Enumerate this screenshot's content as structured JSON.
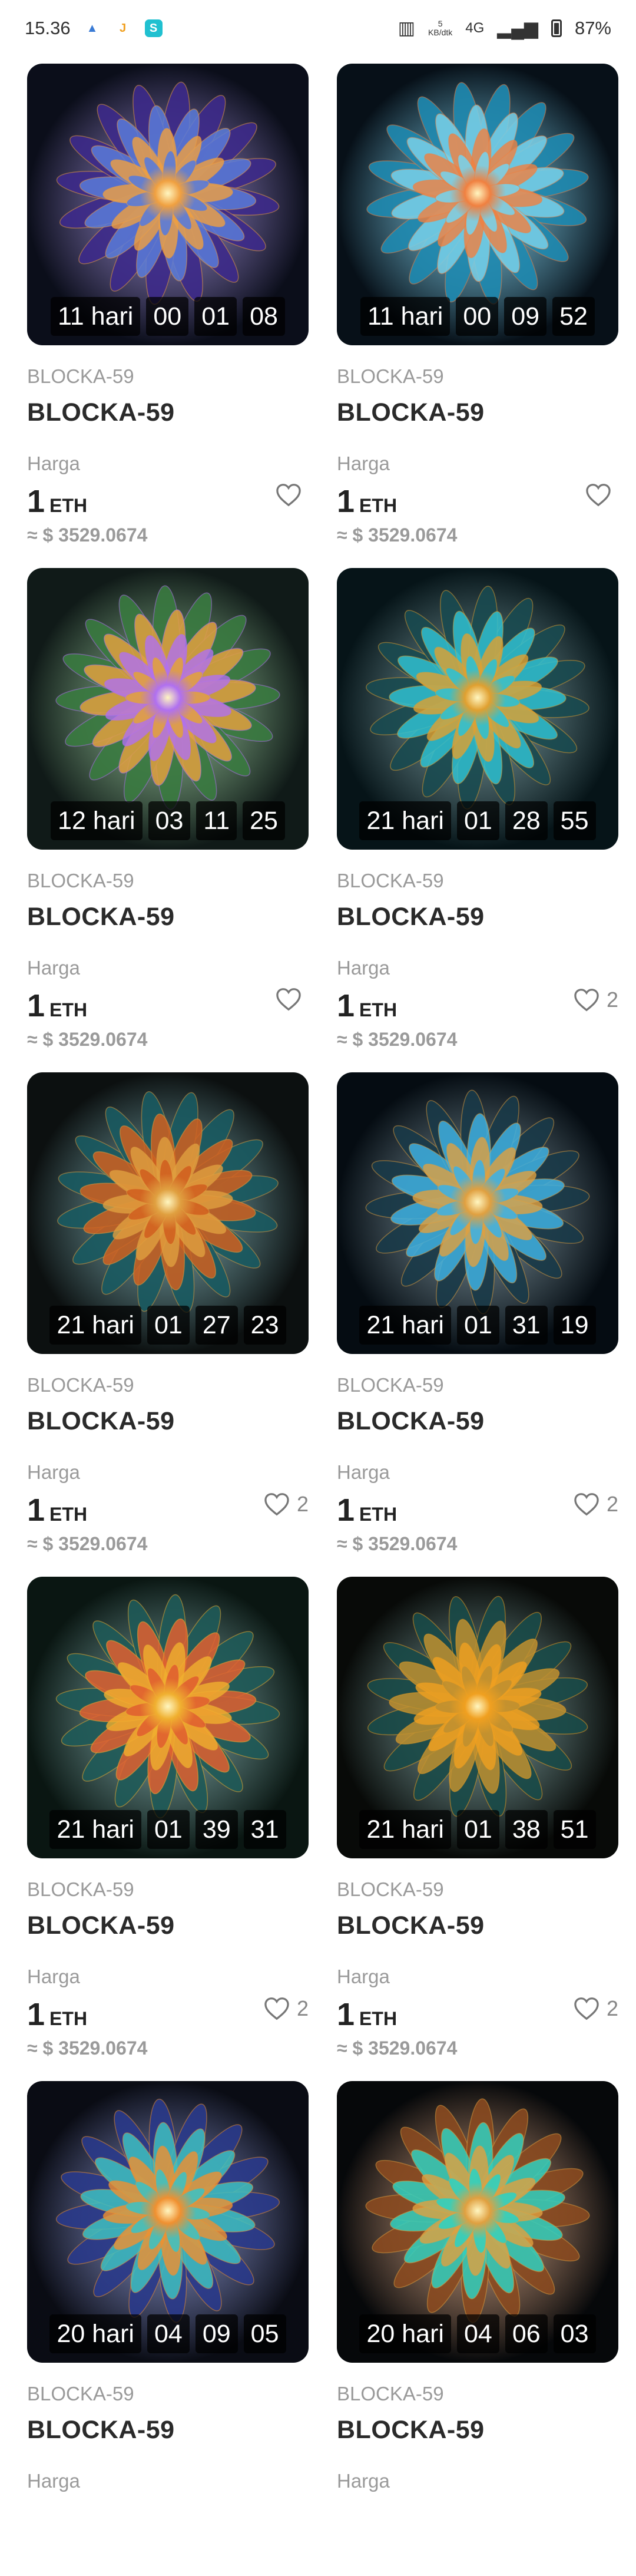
{
  "status_bar": {
    "time": "15.36",
    "net_speed": "5",
    "net_unit": "KB/dtk",
    "network": "4G",
    "battery": "87%"
  },
  "cards": [
    {
      "collection": "BLOCKA-59",
      "title": "BLOCKA-59",
      "price_label": "Harga",
      "price": "1",
      "currency": "ETH",
      "usd": "≈ $ 3529.0674",
      "likes": "",
      "timer": {
        "days": "11 hari",
        "h": "00",
        "m": "01",
        "s": "08"
      },
      "palette": [
        "#0b0e1a",
        "#3d2a8a",
        "#f0a040",
        "#5a7bd8"
      ]
    },
    {
      "collection": "BLOCKA-59",
      "title": "BLOCKA-59",
      "price_label": "Harga",
      "price": "1",
      "currency": "ETH",
      "usd": "≈ $ 3529.0674",
      "likes": "",
      "timer": {
        "days": "11 hari",
        "h": "00",
        "m": "09",
        "s": "52"
      },
      "palette": [
        "#071018",
        "#1f8ab0",
        "#f08040",
        "#7ad0e8"
      ]
    },
    {
      "collection": "BLOCKA-59",
      "title": "BLOCKA-59",
      "price_label": "Harga",
      "price": "1",
      "currency": "ETH",
      "usd": "≈ $ 3529.0674",
      "likes": "",
      "timer": {
        "days": "12 hari",
        "h": "03",
        "m": "11",
        "s": "25"
      },
      "palette": [
        "#101a18",
        "#3a7a40",
        "#b070f0",
        "#e0a040"
      ]
    },
    {
      "collection": "BLOCKA-59",
      "title": "BLOCKA-59",
      "price_label": "Harga",
      "price": "1",
      "currency": "ETH",
      "usd": "≈ $ 3529.0674",
      "likes": "2",
      "timer": {
        "days": "21 hari",
        "h": "01",
        "m": "28",
        "s": "55"
      },
      "palette": [
        "#061418",
        "#1a4a50",
        "#e0a030",
        "#30c0d0"
      ]
    },
    {
      "collection": "BLOCKA-59",
      "title": "BLOCKA-59",
      "price_label": "Harga",
      "price": "1",
      "currency": "ETH",
      "usd": "≈ $ 3529.0674",
      "likes": "2",
      "timer": {
        "days": "21 hari",
        "h": "01",
        "m": "27",
        "s": "23"
      },
      "palette": [
        "#0c1010",
        "#1a5a60",
        "#e0a040",
        "#d06020"
      ]
    },
    {
      "collection": "BLOCKA-59",
      "title": "BLOCKA-59",
      "price_label": "Harga",
      "price": "1",
      "currency": "ETH",
      "usd": "≈ $ 3529.0674",
      "likes": "2",
      "timer": {
        "days": "21 hari",
        "h": "01",
        "m": "31",
        "s": "19"
      },
      "palette": [
        "#050c12",
        "#1a3a48",
        "#e0a040",
        "#40b0e0"
      ]
    },
    {
      "collection": "BLOCKA-59",
      "title": "BLOCKA-59",
      "price_label": "Harga",
      "price": "1",
      "currency": "ETH",
      "usd": "≈ $ 3529.0674",
      "likes": "2",
      "timer": {
        "days": "21 hari",
        "h": "01",
        "m": "39",
        "s": "31"
      },
      "palette": [
        "#0a1612",
        "#1f5a58",
        "#f0b030",
        "#e06030"
      ]
    },
    {
      "collection": "BLOCKA-59",
      "title": "BLOCKA-59",
      "price_label": "Harga",
      "price": "1",
      "currency": "ETH",
      "usd": "≈ $ 3529.0674",
      "likes": "2",
      "timer": {
        "days": "21 hari",
        "h": "01",
        "m": "38",
        "s": "51"
      },
      "palette": [
        "#080a08",
        "#1a4a48",
        "#f0a020",
        "#c09030"
      ]
    },
    {
      "collection": "BLOCKA-59",
      "title": "BLOCKA-59",
      "price_label": "Harga",
      "price": "",
      "currency": "",
      "usd": "",
      "likes": "",
      "timer": {
        "days": "20 hari",
        "h": "04",
        "m": "09",
        "s": "05"
      },
      "palette": [
        "#0a0c14",
        "#2a3a8a",
        "#f09030",
        "#40c0c0"
      ]
    },
    {
      "collection": "BLOCKA-59",
      "title": "BLOCKA-59",
      "price_label": "Harga",
      "price": "",
      "currency": "",
      "usd": "",
      "likes": "",
      "timer": {
        "days": "20 hari",
        "h": "04",
        "m": "06",
        "s": "03"
      },
      "palette": [
        "#06080a",
        "#8a4a20",
        "#e0a040",
        "#30d0c0"
      ]
    }
  ]
}
